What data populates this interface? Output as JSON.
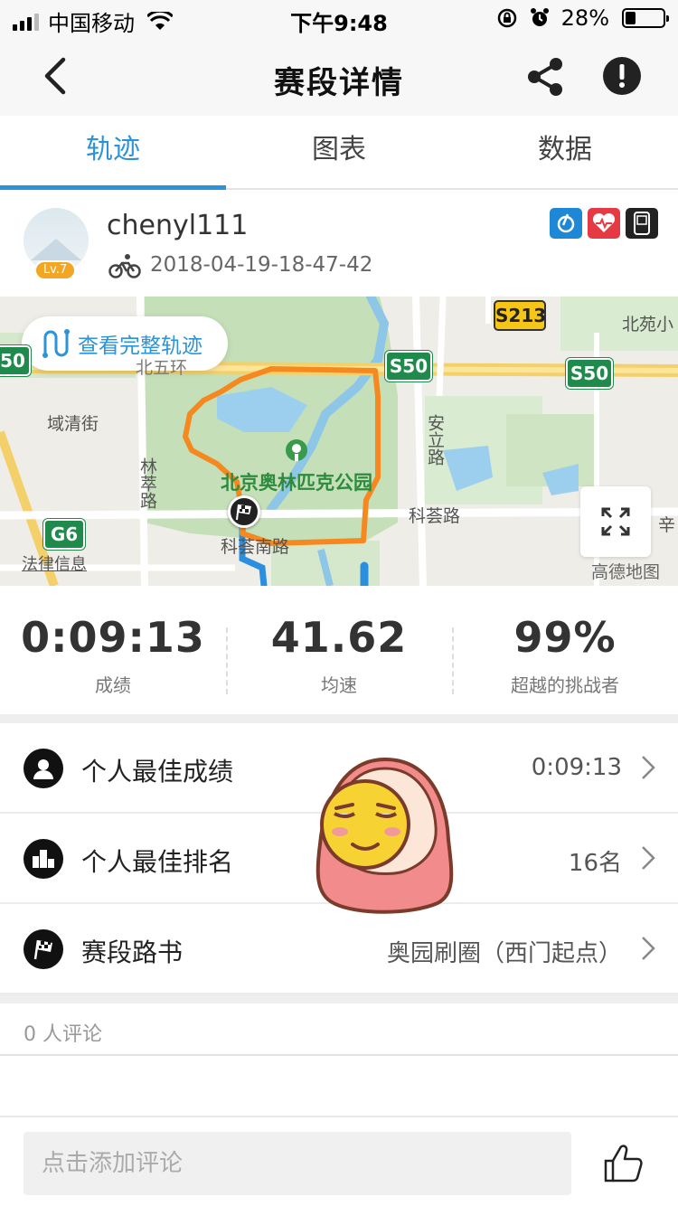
{
  "status_bar": {
    "carrier": "中国移动",
    "time": "下午9:48",
    "battery": "28%",
    "battery_level": 0.28
  },
  "nav": {
    "title": "赛段详情",
    "icons": [
      "back-icon",
      "share-icon",
      "report-icon"
    ]
  },
  "tabs": [
    {
      "label": "轨迹",
      "active": true
    },
    {
      "label": "图表",
      "active": false
    },
    {
      "label": "数据",
      "active": false
    }
  ],
  "user": {
    "name": "chenyl111",
    "level": "Lv.7",
    "datetime": "2018-04-19-18-47-42",
    "activity_icon": "bike-icon",
    "device_icons": [
      "strava-icon",
      "heart-rate-icon",
      "gps-device-icon"
    ]
  },
  "map": {
    "view_full_track": "查看完整轨迹",
    "labels": {
      "s213": "S213",
      "beiyuan": "北苑小",
      "s50_left": "50",
      "beiwuhuan": "北五环",
      "s50_mid": "S50",
      "s50_right": "S50",
      "yuqing": "域清街",
      "anli": "安立路",
      "linsui": "林萃路",
      "park": "北京奥林匹克公园",
      "kehui_right": "科荟路",
      "kehui_left": "科荟南路",
      "g6": "G6",
      "legal": "法律信息",
      "xin": "辛",
      "provider": "高德地图"
    },
    "track_color": "#f5891f",
    "route_color": "#2b8fe0"
  },
  "stats": [
    {
      "value": "0:09:13",
      "label": "成绩"
    },
    {
      "value": "41.62",
      "label": "均速"
    },
    {
      "value": "99%",
      "label": "超越的挑战者"
    }
  ],
  "rows": [
    {
      "icon": "person-icon",
      "label": "个人最佳成绩",
      "value": "0:09:13"
    },
    {
      "icon": "podium-icon",
      "label": "个人最佳排名",
      "value": "16名"
    },
    {
      "icon": "checkered-flag-icon",
      "label": "赛段路书",
      "value": "奥园刷圈（西门起点）"
    }
  ],
  "comments": {
    "count_text": "0 人评论",
    "input_placeholder": "点击添加评论"
  },
  "colors": {
    "accent": "#2b93d8",
    "level_badge": "#f2a623"
  }
}
